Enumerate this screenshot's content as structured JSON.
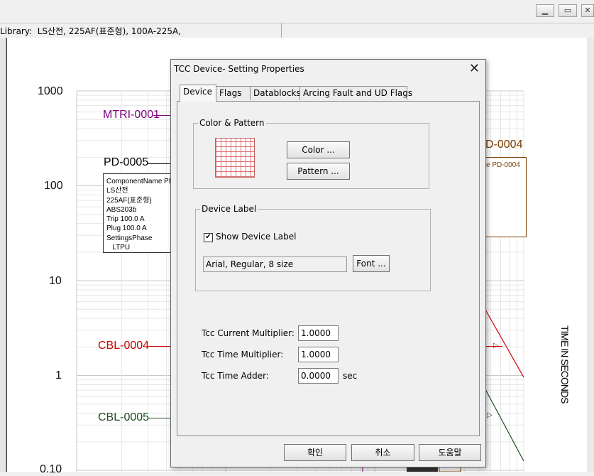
{
  "window": {
    "min_icon": "minimize-icon",
    "max_icon": "maximize-icon",
    "close_icon": "close-icon"
  },
  "status": {
    "library_text": "Library:  LS산전, 225AF(표준형), 100A-225A,"
  },
  "chart": {
    "y_ticks": [
      "1000",
      "100",
      "10",
      "1",
      "0.10"
    ],
    "axis_title": "TIME IN SECONDS",
    "labels": {
      "mtri": "MTRI-0001",
      "pd5": "PD-0005",
      "pd4": "D-0004",
      "cbl4": "CBL-0004",
      "cbl5": "CBL-0005"
    },
    "pd5_info": "ComponentName PD\nLS산전\n225AF(표준형)\nABS203b\nTrip 100.0 A\nPlug 100.0 A\nSettingsPhase\n   LTPU",
    "pd4_info": "e PD-0004",
    "colors": {
      "mtri": "#800080",
      "pd": "#000000",
      "pd4": "#7a3c00",
      "cbl4": "#d00000",
      "cbl5": "#1e4a1e"
    }
  },
  "dialog": {
    "title": "TCC Device- Setting Properties",
    "tabs": [
      "Device",
      "Flags",
      "Datablocks",
      "Arcing Fault and UD Flags"
    ],
    "color_group": {
      "title": "Color & Pattern",
      "color_btn": "Color ...",
      "pattern_btn": "Pattern ..."
    },
    "label_group": {
      "title": "Device Label",
      "show_label": "Show Device Label",
      "show_checked": "✔",
      "font_value": "Arial, Regular, 8 size",
      "font_btn": "Font ..."
    },
    "fields": {
      "current_mult_label": "Tcc Current Multiplier:",
      "current_mult": "1.0000",
      "time_mult_label": "Tcc Time Multiplier:",
      "time_mult": "1.0000",
      "time_adder_label": "Tcc Time Adder:",
      "time_adder": "0.0000",
      "time_adder_unit": "sec"
    },
    "buttons": {
      "ok": "확인",
      "cancel": "취소",
      "help": "도움말"
    }
  }
}
